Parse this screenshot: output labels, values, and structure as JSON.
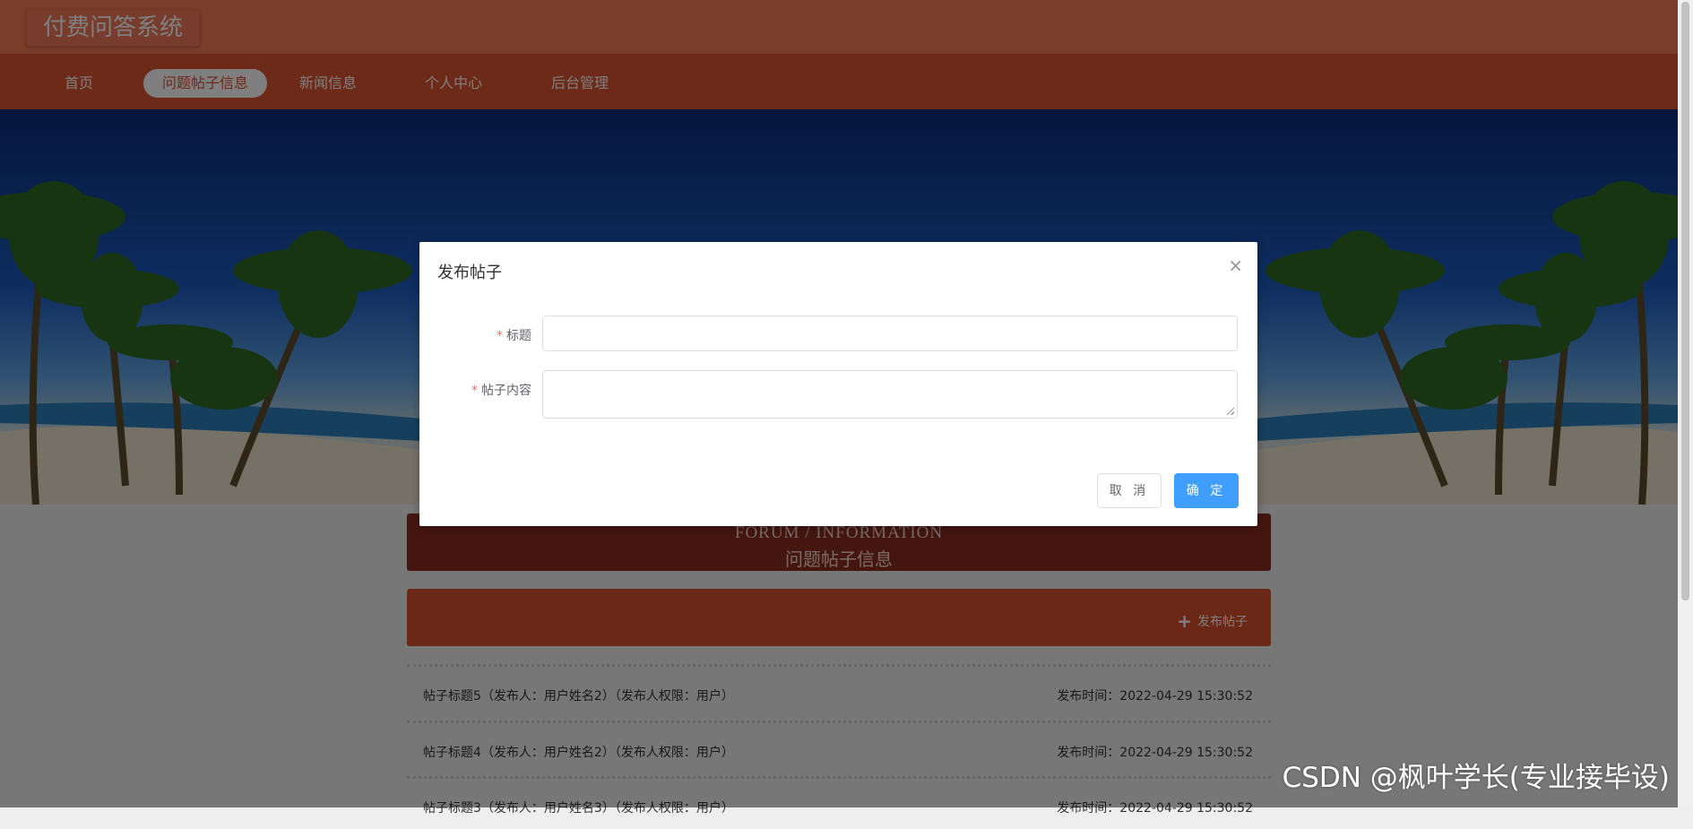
{
  "app": {
    "title": "付费问答系统"
  },
  "nav": {
    "items": [
      {
        "label": "首页",
        "active": false
      },
      {
        "label": "问题帖子信息",
        "active": true
      },
      {
        "label": "新闻信息",
        "active": false
      },
      {
        "label": "个人中心",
        "active": false
      },
      {
        "label": "后台管理",
        "active": false
      }
    ]
  },
  "section": {
    "en_title": "FORUM / INFORMATION",
    "zh_title": "问题帖子信息",
    "post_button": "发布帖子"
  },
  "posts": [
    {
      "title": "帖子标题5（发布人：用户姓名2）（发布人权限：用户）",
      "time": "发布时间：2022-04-29 15:30:52"
    },
    {
      "title": "帖子标题4（发布人：用户姓名2）（发布人权限：用户）",
      "time": "发布时间：2022-04-29 15:30:52"
    },
    {
      "title": "帖子标题3（发布人：用户姓名3）（发布人权限：用户）",
      "time": "发布时间：2022-04-29 15:30:52"
    }
  ],
  "dialog": {
    "title": "发布帖子",
    "fields": {
      "title_label": "标题",
      "title_value": "",
      "content_label": "帖子内容",
      "content_value": ""
    },
    "cancel": "取 消",
    "ok": "确 定"
  },
  "watermark": "CSDN @枫叶学长(专业接毕设)",
  "colors": {
    "header": "#f27a55",
    "nav": "#db5531",
    "primary": "#409eff",
    "required": "#f56c6c"
  }
}
